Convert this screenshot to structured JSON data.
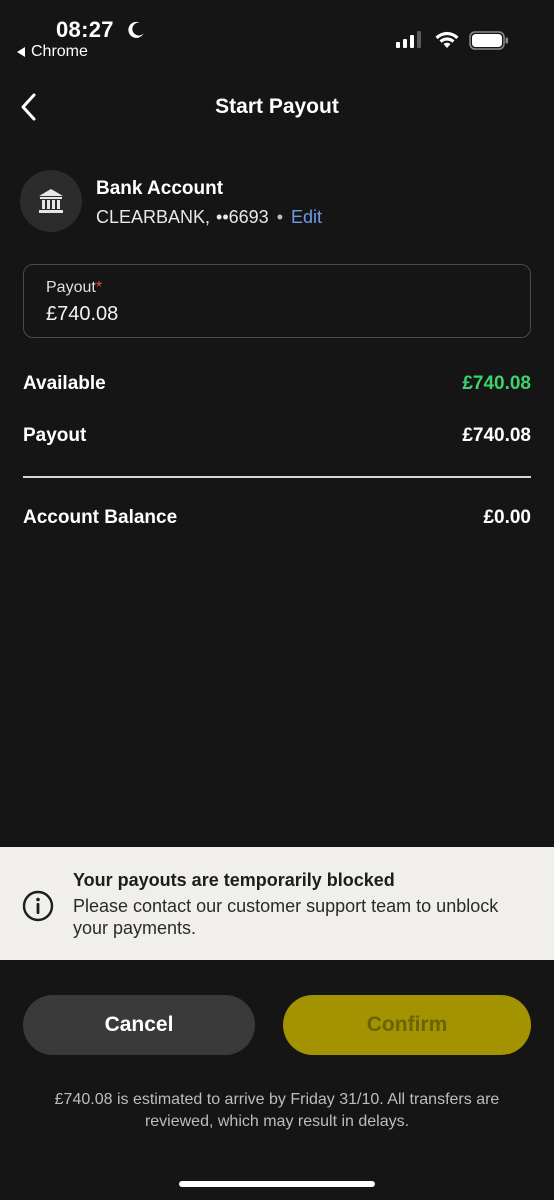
{
  "status_bar": {
    "time": "08:27",
    "back_app": "Chrome",
    "icons": [
      "moon-icon",
      "cellular-signal-icon",
      "wifi-icon",
      "battery-icon"
    ]
  },
  "nav": {
    "title": "Start Payout",
    "back_icon": "chevron-left-icon"
  },
  "bank": {
    "icon": "bank-icon",
    "title": "Bank Account",
    "name": "CLEARBANK,",
    "masked_number": "••6693",
    "separator": "•",
    "edit_label": "Edit"
  },
  "payout_field": {
    "label": "Payout",
    "required_marker": "*",
    "value": "£740.08"
  },
  "summary": {
    "available_label": "Available",
    "available_value": "£740.08",
    "payout_label": "Payout",
    "payout_value": "£740.08",
    "balance_label": "Account Balance",
    "balance_value": "£0.00"
  },
  "notice": {
    "icon": "info-icon",
    "title": "Your payouts are temporarily blocked",
    "text": "Please contact our customer support team to unblock your payments."
  },
  "actions": {
    "cancel_label": "Cancel",
    "confirm_label": "Confirm"
  },
  "footnote": "£740.08 is estimated to arrive by Friday 31/10. All transfers are reviewed, which may result in delays.",
  "colors": {
    "background": "#151515",
    "available_green": "#3dd16c",
    "link_blue": "#6b9ce8",
    "confirm_disabled": "#a39300",
    "notice_bg": "#f1efec"
  }
}
